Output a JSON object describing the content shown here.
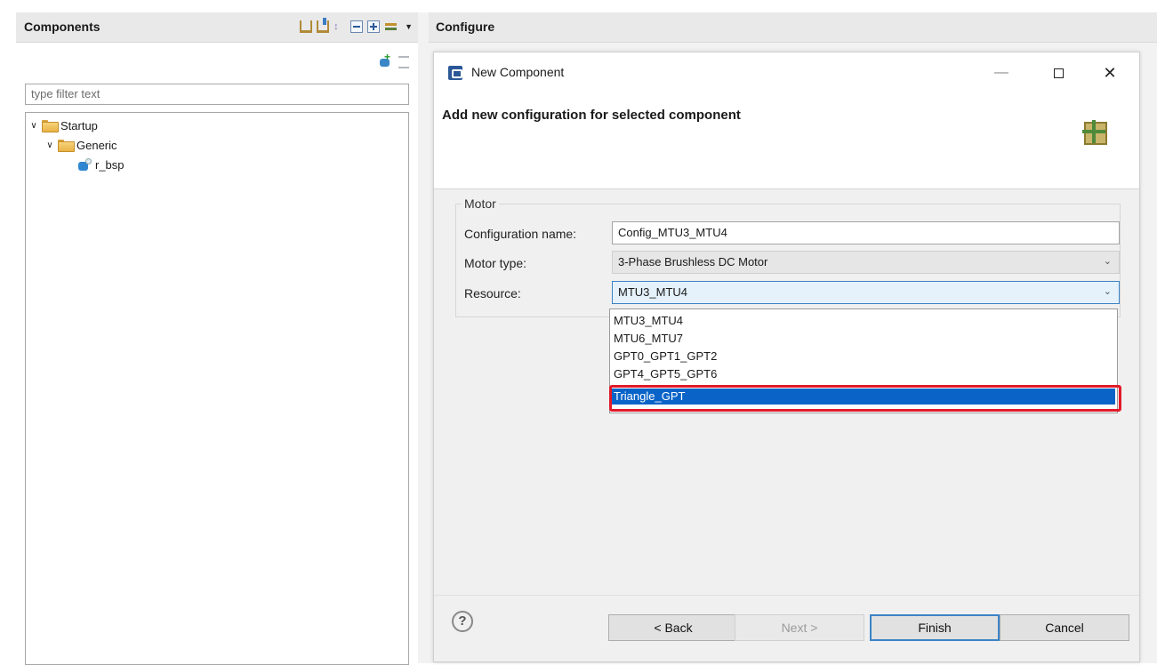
{
  "components_panel": {
    "title": "Components",
    "filter_placeholder": "type filter text",
    "tree": [
      {
        "label": "Startup"
      },
      {
        "label": "Generic"
      },
      {
        "label": "r_bsp"
      }
    ]
  },
  "configure_panel": {
    "title": "Configure"
  },
  "dialog": {
    "title": "New Component",
    "banner_title": "Add new configuration for selected component",
    "group_label": "Motor",
    "config_name_label": "Configuration name:",
    "config_name_value": "Config_MTU3_MTU4",
    "motor_type_label": "Motor type:",
    "motor_type_value": "3-Phase Brushless DC Motor",
    "resource_label": "Resource:",
    "resource_value": "MTU3_MTU4",
    "resource_options": [
      "MTU3_MTU4",
      "MTU6_MTU7",
      "GPT0_GPT1_GPT2",
      "GPT4_GPT5_GPT6",
      "Triangle_GPT"
    ],
    "selected_option": "Triangle_GPT",
    "buttons": {
      "back": "< Back",
      "next": "Next >",
      "finish": "Finish",
      "cancel": "Cancel"
    },
    "help_symbol": "?"
  },
  "colors": {
    "highlight": "#e21a2a",
    "selection": "#0a64c8",
    "active_field": "#e5f1fb"
  }
}
